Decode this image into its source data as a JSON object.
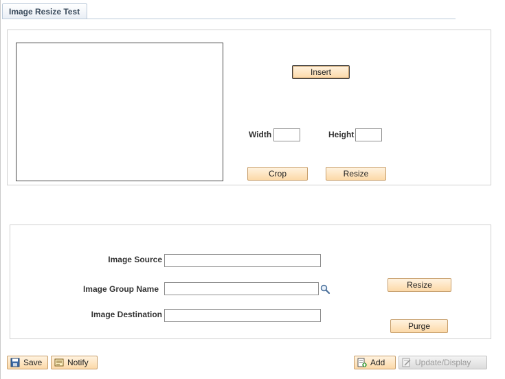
{
  "page": {
    "tab_title": "Image Resize Test"
  },
  "image_panel": {
    "insert_label": "Insert",
    "width_label": "Width",
    "height_label": "Height",
    "width_value": "",
    "height_value": "",
    "crop_label": "Crop",
    "resize_label": "Resize"
  },
  "settings": {
    "source_label": "Image Source",
    "source_value": "",
    "group_label": "Image Group Name",
    "group_value": "",
    "destination_label": "Image Destination",
    "destination_value": "",
    "resize_label": "Resize",
    "purge_label": "Purge"
  },
  "toolbar": {
    "save_label": "Save",
    "notify_label": "Notify",
    "add_label": "Add",
    "update_label": "Update/Display"
  },
  "icons": {
    "save": "save-icon",
    "notify": "notify-icon",
    "add": "add-icon",
    "update": "update-display-icon",
    "lookup": "search-icon"
  },
  "colors": {
    "button_fill": "#fcd9a8",
    "button_border": "#c69d6a",
    "tab_border": "#b9c8d8",
    "disabled_text": "#9a9a9a"
  }
}
